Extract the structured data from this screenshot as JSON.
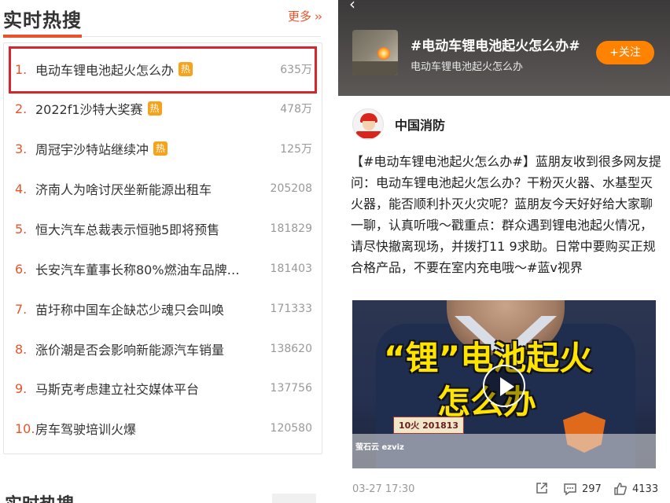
{
  "left_panel": {
    "title": "实时热搜",
    "more_label": "更多",
    "more_chevron": "››",
    "items": [
      {
        "rank": "1.",
        "topic": "电动车锂电池起火怎么办",
        "hot": true,
        "count": "635万"
      },
      {
        "rank": "2.",
        "topic": "2022f1沙特大奖赛",
        "hot": true,
        "count": "478万"
      },
      {
        "rank": "3.",
        "topic": "周冠宇沙特站继续冲",
        "hot": true,
        "count": "125万"
      },
      {
        "rank": "4.",
        "topic": "济南人为啥讨厌坐新能源出租车",
        "hot": false,
        "count": "205208"
      },
      {
        "rank": "5.",
        "topic": "恒大汽车总裁表示恒驰5即将预售",
        "hot": false,
        "count": "181829"
      },
      {
        "rank": "6.",
        "topic": "长安汽车董事长称80%燃油车品牌…",
        "hot": false,
        "count": "181403"
      },
      {
        "rank": "7.",
        "topic": "苗圩称中国车企缺芯少魂只会叫唤",
        "hot": false,
        "count": "171333"
      },
      {
        "rank": "8.",
        "topic": "涨价潮是否会影响新能源汽车销量",
        "hot": false,
        "count": "138620"
      },
      {
        "rank": "9.",
        "topic": "马斯克考虑建立社交媒体平台",
        "hot": false,
        "count": "137756"
      },
      {
        "rank": "10.",
        "topic": "房车驾驶培训火爆",
        "hot": false,
        "count": "120580"
      }
    ],
    "hot_badge_label": "热",
    "next_section_title": "实时热搜"
  },
  "right_panel": {
    "topic_name": "#电动车锂电池起火怎么办#",
    "topic_sub": "电动车锂电池起火怎么办",
    "follow_label": "+关注",
    "author_name": "中国消防",
    "post_text": "【#电动车锂电池起火怎么办#】蓝朋友收到很多网友提问：电动车锂电池起火怎么办？干粉灭火器、水基型灭火器，能否顺利扑灭火灾呢？蓝朋友今天好好给大家聊一聊，认真听哦～戳重点：群众遇到锂电池起火情况，请尽快撤离现场，并拨打11 9求助。日常中要购买正规合格产品，不要在室内充电哦～#蓝v视界",
    "video": {
      "caption_line1": "“锂”电池起火",
      "caption_line2": "怎么办",
      "badge_label": "10火 201813",
      "cam_logo": "萤石云 ezviz"
    },
    "post_time": "03-27 17:30",
    "comments": "297",
    "likes": "4133"
  },
  "colors": {
    "accent": "#e8542a",
    "highlight_border": "#d7262b",
    "hot_badge": "#f7a21b",
    "follow_button": "#ff8200",
    "video_caption": "#ffe400"
  },
  "icons": {
    "share": "share-icon",
    "comment": "comment-icon",
    "like": "thumbs-up-icon",
    "play": "play-icon",
    "back": "back-arrow-icon"
  }
}
